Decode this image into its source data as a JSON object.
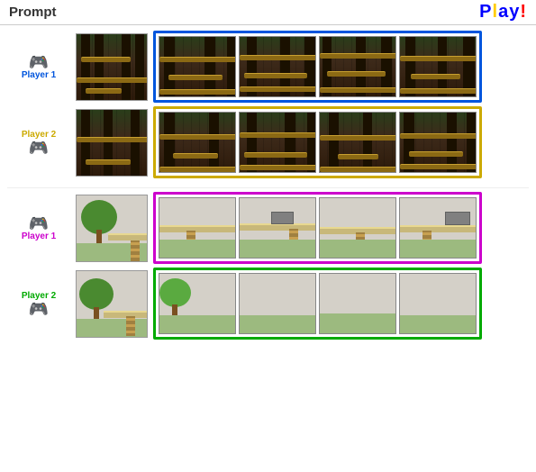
{
  "header": {
    "prompt_label": "Prompt",
    "play_label": "Play!"
  },
  "scenarios": [
    {
      "id": "forest",
      "player1": {
        "label": "Player 1",
        "border_color": "blue",
        "label_color": "label-blue",
        "strip_class": "blue-border"
      },
      "player2": {
        "label": "Player 2",
        "border_color": "gold",
        "label_color": "label-gold",
        "strip_class": "gold-border"
      }
    },
    {
      "id": "outdoor",
      "player1": {
        "label": "Player 1",
        "border_color": "magenta",
        "label_color": "label-magenta",
        "strip_class": "magenta-border"
      },
      "player2": {
        "label": "Player 2",
        "border_color": "green",
        "label_color": "label-green",
        "strip_class": "green-border"
      }
    }
  ],
  "controller_glyph": "🎮"
}
